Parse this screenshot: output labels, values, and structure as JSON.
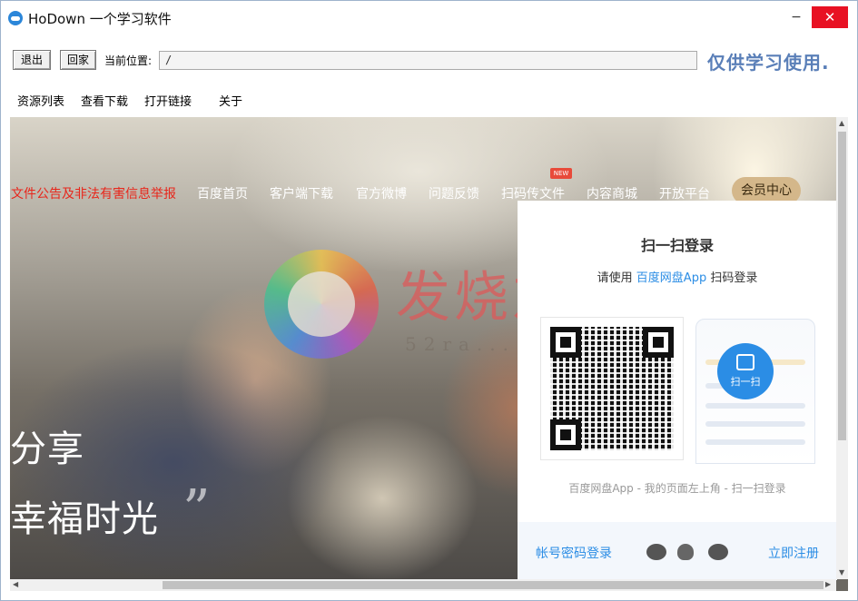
{
  "window": {
    "title": "HoDown  一个学习软件",
    "minimize_label": "−",
    "close_label": "✕"
  },
  "toolbar": {
    "exit_label": "退出",
    "home_label": "回家",
    "location_label": "当前位置:",
    "location_value": "/",
    "notice": "仅供学习使用."
  },
  "menu": [
    {
      "label": "资源列表"
    },
    {
      "label": "查看下载"
    },
    {
      "label": "打开链接"
    },
    {
      "label": "关于"
    }
  ],
  "site_nav": {
    "report": "文件公告及非法有害信息举报",
    "links": [
      "百度首页",
      "客户端下载",
      "官方微博",
      "问题反馈",
      "扫码传文件",
      "内容商城",
      "开放平台"
    ],
    "new_badge": "NEW",
    "vip": "会员中心"
  },
  "slogan": {
    "line1": "分享",
    "line2": "幸福时光",
    "quote": "”"
  },
  "watermark": {
    "brand": "发烧友",
    "sub": "52ra..."
  },
  "login": {
    "title": "扫一扫登录",
    "hint_prefix": "请使用 ",
    "hint_app": "百度网盘App",
    "hint_suffix": " 扫码登录",
    "scan_label": "扫一扫",
    "footer": "百度网盘App - 我的页面左上角 - 扫一扫登录",
    "account_login": "帐号密码登录",
    "register": "立即注册"
  },
  "colors": {
    "accent_blue": "#2b8de5",
    "alert_red": "#e8261b",
    "vip_gold": "#d4b78a",
    "close_red": "#e81123"
  },
  "icons": [
    "app-cloud-icon",
    "weibo-icon",
    "qq-icon",
    "wechat-icon"
  ]
}
